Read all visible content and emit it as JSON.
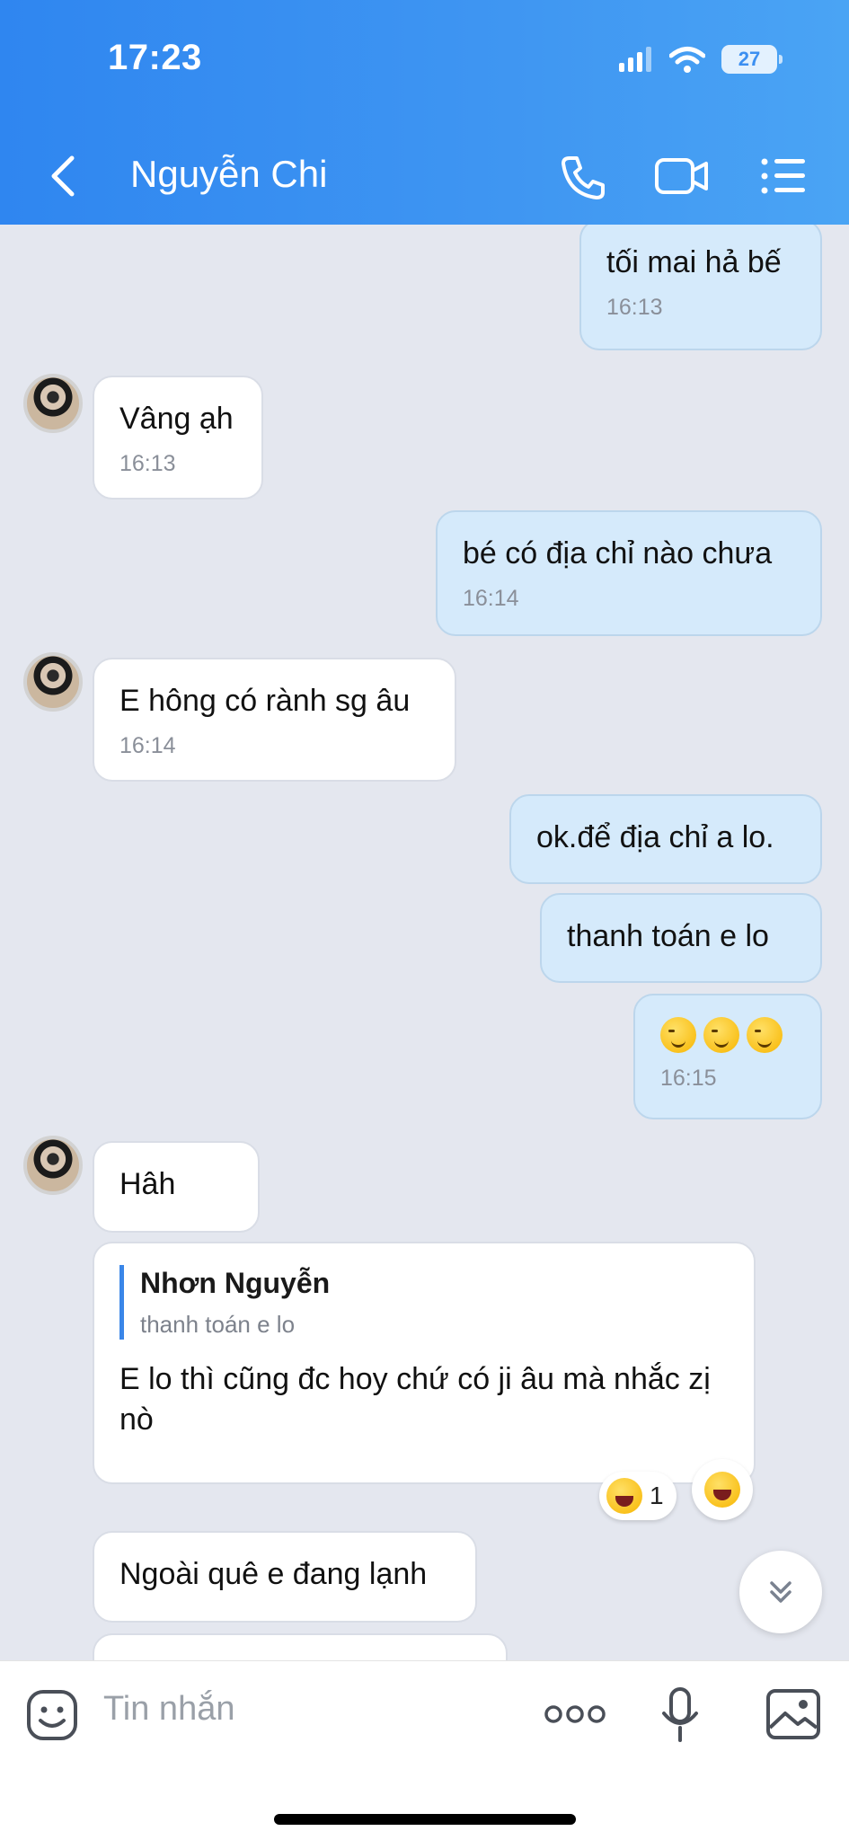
{
  "status_bar": {
    "time": "17:23",
    "battery": "27"
  },
  "header": {
    "title": "Nguyễn Chi"
  },
  "messages": [
    {
      "dir": "out",
      "text": "tối mai hả bế",
      "time": "16:13"
    },
    {
      "dir": "in",
      "text": "Vâng ạh",
      "time": "16:13"
    },
    {
      "dir": "out",
      "text": "bé có địa chỉ nào chưa",
      "time": "16:14"
    },
    {
      "dir": "in",
      "text": "E hông có rành sg âu",
      "time": "16:14"
    },
    {
      "dir": "out",
      "text": "ok.để địa chỉ a lo."
    },
    {
      "dir": "out",
      "text": "thanh toán e lo"
    },
    {
      "dir": "out",
      "emoji": [
        "wink",
        "wink",
        "wink"
      ],
      "time": "16:15"
    },
    {
      "dir": "in",
      "text": "Hâh"
    },
    {
      "dir": "in",
      "reply_to": {
        "name": "Nhơn Nguyễn",
        "text": "thanh toán e lo"
      },
      "text": "E lo thì cũng đc hoy chứ có ji âu mà nhắc zị nò",
      "reaction": {
        "emoji": "laugh",
        "count": "1"
      }
    },
    {
      "dir": "in",
      "text": "Ngoài quê e đang lạnh"
    }
  ],
  "input": {
    "placeholder": "Tin nhắn",
    "more_label": "ooo"
  },
  "colors": {
    "header_start": "#2f86f0",
    "header_end": "#4aa4f4",
    "bubble_out": "#d5eafb",
    "bubble_in": "#ffffff",
    "chat_bg": "#e4e7ef"
  },
  "icons": [
    "back-icon",
    "phone-icon",
    "video-icon",
    "menu-icon",
    "sticker-icon",
    "mic-icon",
    "image-icon",
    "chevron-double-down-icon",
    "signal-icon",
    "wifi-icon"
  ]
}
